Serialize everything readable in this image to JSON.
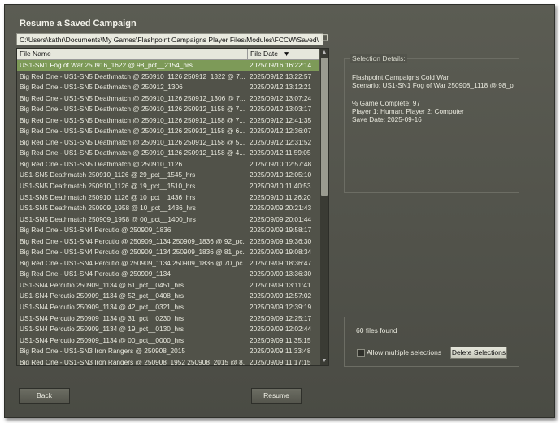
{
  "dialog": {
    "title": "Resume a Saved Campaign"
  },
  "path": {
    "value": "C:\\Users\\kathr\\Documents\\My Games\\Flashpoint Campaigns Player Files\\Modules\\FCCW\\Saved\\"
  },
  "icons": {
    "folder": "folder-icon",
    "sort": "sort-down-icon"
  },
  "list": {
    "headers": {
      "name": "File Name",
      "date": "File Date",
      "sort_indicator": "▼"
    },
    "rows": [
      {
        "name": "US1-SN1 Fog of War 250916_1622 @ 98_pct__2154_hrs",
        "date": "2025/09/16 16:22:14"
      },
      {
        "name": "Big Red One - US1-SN5 Deathmatch @ 250910_1126 250912_1322 @ 7...",
        "date": "2025/09/12 13:22:57"
      },
      {
        "name": "Big Red One - US1-SN5 Deathmatch @ 250912_1306",
        "date": "2025/09/12 13:12:21"
      },
      {
        "name": "Big Red One - US1-SN5 Deathmatch @ 250910_1126 250912_1306 @ 7...",
        "date": "2025/09/12 13:07:24"
      },
      {
        "name": "Big Red One - US1-SN5 Deathmatch @ 250910_1126 250912_1158 @ 7...",
        "date": "2025/09/12 13:03:17"
      },
      {
        "name": "Big Red One - US1-SN5 Deathmatch @ 250910_1126 250912_1158 @ 7...",
        "date": "2025/09/12 12:41:35"
      },
      {
        "name": "Big Red One - US1-SN5 Deathmatch @ 250910_1126 250912_1158 @ 6...",
        "date": "2025/09/12 12:36:07"
      },
      {
        "name": "Big Red One - US1-SN5 Deathmatch @ 250910_1126 250912_1158 @ 5...",
        "date": "2025/09/12 12:31:52"
      },
      {
        "name": "Big Red One - US1-SN5 Deathmatch @ 250910_1126 250912_1158 @ 4...",
        "date": "2025/09/12 11:59:05"
      },
      {
        "name": "Big Red One - US1-SN5 Deathmatch @ 250910_1126",
        "date": "2025/09/10 12:57:48"
      },
      {
        "name": "US1-SN5 Deathmatch 250910_1126 @ 29_pct__1545_hrs",
        "date": "2025/09/10 12:05:10"
      },
      {
        "name": "US1-SN5 Deathmatch 250910_1126 @ 19_pct__1510_hrs",
        "date": "2025/09/10 11:40:53"
      },
      {
        "name": "US1-SN5 Deathmatch 250910_1126 @ 10_pct__1436_hrs",
        "date": "2025/09/10 11:26:20"
      },
      {
        "name": "US1-SN5 Deathmatch 250909_1958 @ 10_pct__1436_hrs",
        "date": "2025/09/09 20:21:43"
      },
      {
        "name": "US1-SN5 Deathmatch 250909_1958 @ 00_pct__1400_hrs",
        "date": "2025/09/09 20:01:44"
      },
      {
        "name": "Big Red One - US1-SN4 Percutio @ 250909_1836",
        "date": "2025/09/09 19:58:17"
      },
      {
        "name": "Big Red One - US1-SN4 Percutio @ 250909_1134 250909_1836 @ 92_pc...",
        "date": "2025/09/09 19:36:30"
      },
      {
        "name": "Big Red One - US1-SN4 Percutio @ 250909_1134 250909_1836 @ 81_pc...",
        "date": "2025/09/09 19:08:34"
      },
      {
        "name": "Big Red One - US1-SN4 Percutio @ 250909_1134 250909_1836 @ 70_pc...",
        "date": "2025/09/09 18:36:47"
      },
      {
        "name": "Big Red One - US1-SN4 Percutio @ 250909_1134",
        "date": "2025/09/09 13:36:30"
      },
      {
        "name": "US1-SN4 Percutio 250909_1134 @ 61_pct__0451_hrs",
        "date": "2025/09/09 13:11:41"
      },
      {
        "name": "US1-SN4 Percutio 250909_1134 @ 52_pct__0408_hrs",
        "date": "2025/09/09 12:57:02"
      },
      {
        "name": "US1-SN4 Percutio 250909_1134 @ 42_pct__0321_hrs",
        "date": "2025/09/09 12:39:19"
      },
      {
        "name": "US1-SN4 Percutio 250909_1134 @ 31_pct__0230_hrs",
        "date": "2025/09/09 12:25:17"
      },
      {
        "name": "US1-SN4 Percutio 250909_1134 @ 19_pct__0130_hrs",
        "date": "2025/09/09 12:02:44"
      },
      {
        "name": "US1-SN4 Percutio 250909_1134 @ 00_pct__0000_hrs",
        "date": "2025/09/09 11:35:15"
      },
      {
        "name": "Big Red One - US1-SN3 Iron Rangers @ 250908_2015",
        "date": "2025/09/09 11:33:48"
      },
      {
        "name": "Big Red One - US1-SN3 Iron Rangers @ 250908_1952 250908_2015 @ 8...",
        "date": "2025/09/09 11:17:15"
      }
    ]
  },
  "details": {
    "legend": "Selection Details:",
    "lines": [
      "Flashpoint Campaigns Cold War",
      "Scenario: US1-SN1 Fog of War 250908_1118 @ 98_pct",
      "",
      "% Game Complete: 97",
      "Player 1: Human, Player 2: Computer",
      "Save Date: 2025-09-16"
    ]
  },
  "status": {
    "files_found": "60 files found",
    "allow_multiple": "Allow multiple selections",
    "delete_label": "Delete Selections"
  },
  "buttons": {
    "back": "Back",
    "resume": "Resume"
  }
}
